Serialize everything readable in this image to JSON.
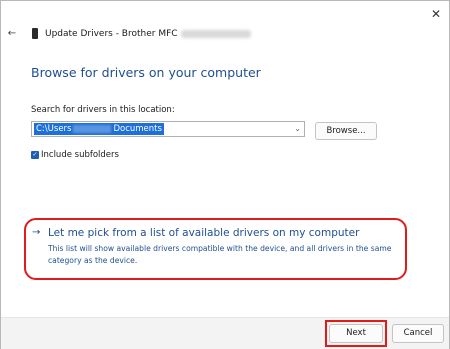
{
  "window": {
    "title": "Update Drivers - Brother MFC",
    "back_glyph": "←",
    "close_glyph": "✕"
  },
  "heading": "Browse for drivers on your computer",
  "search": {
    "label": "Search for drivers in this location:",
    "path_prefix": "C:\\Users",
    "path_suffix": "Documents",
    "dropdown_glyph": "⌄",
    "browse_label": "Browse..."
  },
  "include_subfolders": {
    "label": "Include subfolders",
    "checked": true,
    "check_glyph": "✓"
  },
  "pick_option": {
    "arrow_glyph": "→",
    "title": "Let me pick from a list of available drivers on my computer",
    "description": "This list will show available drivers compatible with the device, and all drivers in the same category as the device."
  },
  "footer": {
    "next_label": "Next",
    "cancel_label": "Cancel"
  },
  "colors": {
    "accent": "#1f4e91",
    "highlight": "#e11a1a",
    "selection": "#1e6fd9"
  },
  "icons": [
    "back-arrow-icon",
    "printer-device-icon",
    "close-icon",
    "chevron-down-icon",
    "checkmark-icon",
    "right-arrow-icon"
  ]
}
